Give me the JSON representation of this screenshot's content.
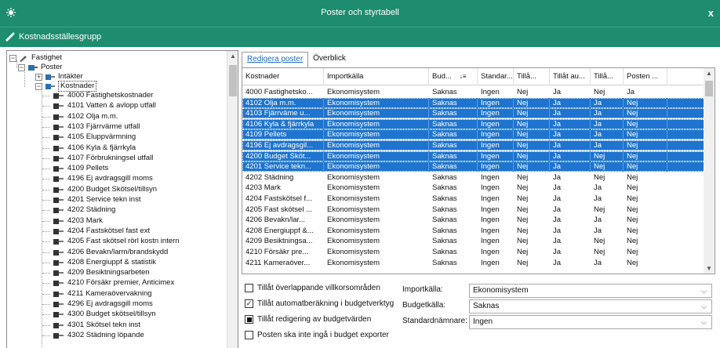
{
  "window": {
    "title": "Poster och styrtabell",
    "close_label": "x"
  },
  "toolbar": {
    "group_label": "Kostnadsställesgrupp"
  },
  "tree": {
    "root": "Fastighet",
    "level1": "Poster",
    "intakter": "Intäkter",
    "kostnader": "Kostnader",
    "items": [
      "4000 Fastighetskostnader",
      "4101 Vatten & avlopp utfall",
      "4102 Olja m.m.",
      "4103 Fjärrvärme utfall",
      "4105 Eluppvärmning",
      "4106 Kyla & fjärrkyla",
      "4107 Förbrukningsel utfall",
      "4109 Pellets",
      "4196 Ej avdragsgill moms",
      "4200 Budget Skötsel/tillsyn",
      "4201 Service tekn inst",
      "4202 Städning",
      "4203 Mark",
      "4204 Fastskötsel fast ext",
      "4205 Fast skötsel rörl kostn intern",
      "4206 Bevakn/larm/brandskydd",
      "4208 Energiuppf & statistik",
      "4209 Besiktningsarbeten",
      "4210 Försäkr premier, Anticimex",
      "4211 Kameraövervakning",
      "4296 Ej avdragsgill moms",
      "4300 Budget skötsel/tillsyn",
      "4301 Skötsel tekn inst",
      "4302 Städning löpande"
    ]
  },
  "tabs": [
    "Redigera poster",
    "Överblick"
  ],
  "grid": {
    "columns": [
      "Kostnader",
      "Importkälla",
      "Bud...",
      "Standar...",
      "Tillå...",
      "Tillåt au...",
      "Tillå...",
      "Posten ..."
    ],
    "rows": [
      {
        "selected": false,
        "cells": [
          "4000 Fastighetsko...",
          "Ekonomisystem",
          "Saknas",
          "Ingen",
          "Nej",
          "Ja",
          "Nej",
          "Ja"
        ]
      },
      {
        "selected": true,
        "cells": [
          "4102 Olja m.m.",
          "Ekonomisystem",
          "Saknas",
          "Ingen",
          "Nej",
          "Ja",
          "Ja",
          "Nej"
        ]
      },
      {
        "selected": true,
        "cells": [
          "4103 Fjärrväme u...",
          "Ekonomisystem",
          "Saknas",
          "Ingen",
          "Nej",
          "Ja",
          "Ja",
          "Nej"
        ]
      },
      {
        "selected": true,
        "cells": [
          "4106 Kyla & fjärrkyla",
          "Ekonomisystem",
          "Saknas",
          "Ingen",
          "Nej",
          "Ja",
          "Ja",
          "Nej"
        ]
      },
      {
        "selected": true,
        "cells": [
          "4109 Pellets",
          "Ekonomisystem",
          "Saknas",
          "Ingen",
          "Nej",
          "Ja",
          "Ja",
          "Nej"
        ]
      },
      {
        "selected": true,
        "cells": [
          "4196 Ej avdragsgil...",
          "Ekonomisystem",
          "Saknas",
          "Ingen",
          "Nej",
          "Ja",
          "Ja",
          "Nej"
        ]
      },
      {
        "selected": true,
        "cells": [
          "4200 Budget Sköt...",
          "Ekonomisystem",
          "Saknas",
          "Ingen",
          "Nej",
          "Ja",
          "Nej",
          "Nej"
        ]
      },
      {
        "selected": true,
        "cells": [
          "4201 Service tekn...",
          "Ekonomisystem",
          "Saknas",
          "Ingen",
          "Nej",
          "Ja",
          "Nej",
          "Nej"
        ]
      },
      {
        "selected": false,
        "cells": [
          "4202 Städning",
          "Ekonomisystem",
          "Saknas",
          "Ingen",
          "Nej",
          "Ja",
          "Nej",
          "Nej"
        ]
      },
      {
        "selected": false,
        "cells": [
          "4203 Mark",
          "Ekonomisystem",
          "Saknas",
          "Ingen",
          "Nej",
          "Ja",
          "Ja",
          "Nej"
        ]
      },
      {
        "selected": false,
        "cells": [
          "4204 Fastskötsel f...",
          "Ekonomisystem",
          "Saknas",
          "Ingen",
          "Nej",
          "Ja",
          "Ja",
          "Nej"
        ]
      },
      {
        "selected": false,
        "cells": [
          "4205 Fast skötsel ...",
          "Ekonomisystem",
          "Saknas",
          "Ingen",
          "Nej",
          "Ja",
          "Nej",
          "Nej"
        ]
      },
      {
        "selected": false,
        "cells": [
          "4206 Bevakn/lar...",
          "Ekonomisystem",
          "Saknas",
          "Ingen",
          "Nej",
          "Ja",
          "Ja",
          "Nej"
        ]
      },
      {
        "selected": false,
        "cells": [
          "4208 Energiuppf &...",
          "Ekonomisystem",
          "Saknas",
          "Ingen",
          "Nej",
          "Ja",
          "Ja",
          "Nej"
        ]
      },
      {
        "selected": false,
        "cells": [
          "4209 Besiktningsa...",
          "Ekonomisystem",
          "Saknas",
          "Ingen",
          "Nej",
          "Ja",
          "Nej",
          "Nej"
        ]
      },
      {
        "selected": false,
        "cells": [
          "4210 Försäkr pre...",
          "Ekonomisystem",
          "Saknas",
          "Ingen",
          "Nej",
          "Ja",
          "Nej",
          "Nej"
        ]
      },
      {
        "selected": false,
        "cells": [
          "4211 Kameraöver...",
          "Ekonomisystem",
          "Saknas",
          "Ingen",
          "Nej",
          "Ja",
          "Ja",
          "Nej"
        ]
      }
    ]
  },
  "options": {
    "checkboxes": [
      {
        "label": "Tillåt överlappande villkorsområden",
        "state": "unchecked"
      },
      {
        "label": "Tillåt automatberäkning i budgetverktyg",
        "state": "checked"
      },
      {
        "label": "Tillåt redigering av budgetvärden",
        "state": "indeterminate"
      },
      {
        "label": "Posten ska inte ingå i budget exporter",
        "state": "unchecked"
      }
    ],
    "fields": [
      {
        "label": "Importkälla:",
        "value": "Ekonomisystem"
      },
      {
        "label": "Budgetkälla:",
        "value": "Saknas"
      },
      {
        "label": "Standardnämnare:",
        "value": "Ingen"
      }
    ]
  },
  "colors": {
    "titlebar": "#1e8c6e",
    "selection": "#1e74cf"
  }
}
